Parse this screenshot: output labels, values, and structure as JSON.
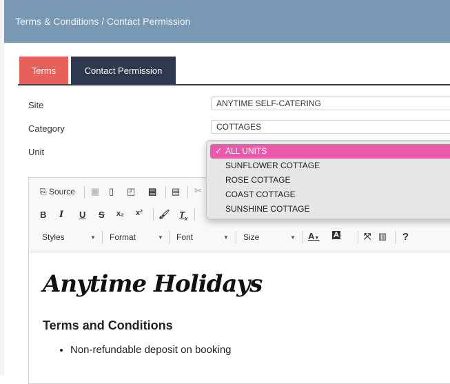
{
  "header": {
    "title": "Terms & Conditions / Contact Permission"
  },
  "tabs": [
    {
      "label": "Terms",
      "color": "#e8605a"
    },
    {
      "label": "Contact Permission",
      "color": "#2e3950"
    }
  ],
  "form": {
    "site_label": "Site",
    "site_value": "ANYTIME SELF-CATERING",
    "category_label": "Category",
    "category_value": "COTTAGES",
    "unit_label": "Unit"
  },
  "toolbar": {
    "source_label": "Source",
    "styles": "Styles",
    "format": "Format",
    "font": "Font",
    "size": "Size"
  },
  "content": {
    "logo": "Anytime Holidays",
    "heading": "Terms and Conditions",
    "bullets": [
      "Non-refundable deposit on booking"
    ]
  },
  "unit_dropdown": {
    "selected": "ALL UNITS",
    "check": "✓",
    "options": [
      "ALL UNITS",
      "SUNFLOWER COTTAGE",
      "ROSE COTTAGE",
      "COAST COTTAGE",
      "SUNSHINE COTTAGE"
    ],
    "highlight": "#ea5aa8"
  }
}
